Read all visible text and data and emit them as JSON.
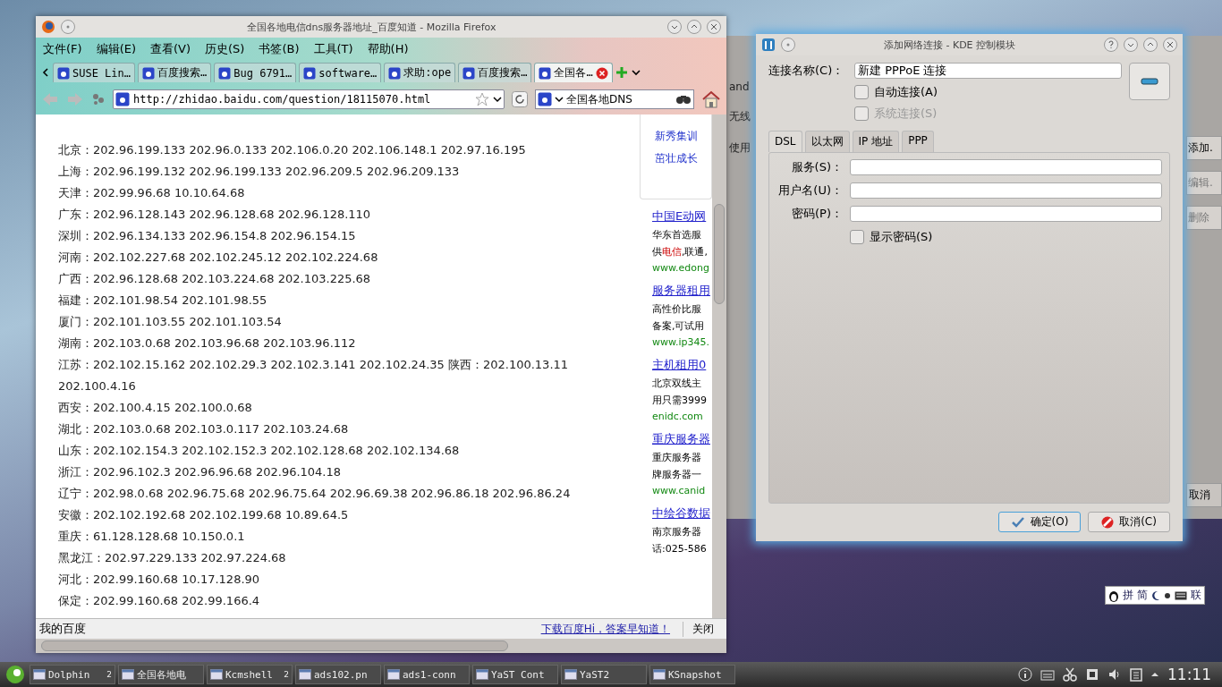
{
  "firefox": {
    "title": "全国各地电信dns服务器地址_百度知道 - Mozilla Firefox",
    "menu": [
      "文件(F)",
      "编辑(E)",
      "查看(V)",
      "历史(S)",
      "书签(B)",
      "工具(T)",
      "帮助(H)"
    ],
    "tabs": [
      {
        "label": "SUSE Lin…",
        "selected": false
      },
      {
        "label": "百度搜索…",
        "selected": false
      },
      {
        "label": "Bug 6791…",
        "selected": false
      },
      {
        "label": "software…",
        "selected": false
      },
      {
        "label": "求助:ope",
        "selected": false
      },
      {
        "label": "百度搜索…",
        "selected": false
      },
      {
        "label": "全国各…",
        "selected": true
      }
    ],
    "address": "http://zhidao.baidu.com/question/18115070.html",
    "search": "全国各地DNS",
    "lines": [
      "北京：202.96.199.133  202.96.0.133  202.106.0.20  202.106.148.1  202.97.16.195",
      "上海：202.96.199.132  202.96.199.133  202.96.209.5  202.96.209.133",
      "天津：202.99.96.68  10.10.64.68",
      "广东：202.96.128.143  202.96.128.68  202.96.128.110",
      "深圳：202.96.134.133  202.96.154.8  202.96.154.15",
      "河南：202.102.227.68  202.102.245.12  202.102.224.68",
      "广西：202.96.128.68  202.103.224.68  202.103.225.68",
      "福建：202.101.98.54  202.101.98.55",
      "厦门：202.101.103.55  202.101.103.54",
      "湖南：202.103.0.68  202.103.96.68  202.103.96.112",
      "江苏：202.102.15.162  202.102.29.3  202.102.3.141  202.102.24.35 陕西：202.100.13.11 202.100.4.16",
      "西安：202.100.4.15  202.100.0.68",
      "湖北：202.103.0.68  202.103.0.117  202.103.24.68",
      "山东：202.102.154.3  202.102.152.3  202.102.128.68  202.102.134.68",
      "浙江：202.96.102.3  202.96.96.68  202.96.104.18",
      "辽宁：202.98.0.68  202.96.75.68  202.96.75.64  202.96.69.38  202.96.86.18  202.96.86.24",
      "安徽：202.102.192.68  202.102.199.68  10.89.64.5",
      "重庆：61.128.128.68  10.150.0.1",
      "黑龙江：202.97.229.133  202.97.224.68",
      "河北：202.99.160.68  10.17.128.90",
      "保定：202.99.160.68  202.99.166.4"
    ],
    "side_links": [
      "新秀集训",
      "茁壮成长"
    ],
    "ads": [
      {
        "title": "中国E动网",
        "lines": [
          [
            {
              "text": "华东首选服"
            }
          ],
          [
            {
              "text": "供"
            },
            {
              "text": "电信",
              "highlight": true
            },
            {
              "text": ",联通,"
            }
          ]
        ],
        "url": "www.edong"
      },
      {
        "title": "服务器租用",
        "lines": [
          [
            {
              "text": "高性价比服"
            }
          ],
          [
            {
              "text": "备案,可试用"
            }
          ]
        ],
        "url": "www.ip345."
      },
      {
        "title": "主机租用0",
        "lines": [
          [
            {
              "text": "北京双线主"
            }
          ],
          [
            {
              "text": "用只需3999"
            }
          ]
        ],
        "url": "enidc.com"
      },
      {
        "title": "重庆服务器",
        "lines": [
          [
            {
              "text": "重庆服务器"
            }
          ],
          [
            {
              "text": "牌服务器一"
            }
          ]
        ],
        "url": "www.canid"
      },
      {
        "title": "中绘谷数据",
        "lines": [
          [
            {
              "text": "南京服务器"
            }
          ],
          [
            {
              "text": "话:025-586"
            }
          ]
        ]
      }
    ],
    "find_bar": {
      "left": "我的百度",
      "link": "下载百度Hi，答案早知道！",
      "close": "关闭"
    }
  },
  "background_window": {
    "left_texts": [
      "and",
      "无线",
      "使用"
    ],
    "buttons": [
      {
        "label": "添加.",
        "disabled": false
      },
      {
        "label": "编辑.",
        "disabled": true
      },
      {
        "label": "删除",
        "disabled": true
      }
    ],
    "cancel": "取消"
  },
  "dialog": {
    "title": "添加网络连接 - KDE 控制模块",
    "name_label": "连接名称(C)：",
    "name_value": "新建 PPPoE 连接",
    "checks": [
      {
        "label": "自动连接(A)",
        "checked": false,
        "disabled": false
      },
      {
        "label": "系统连接(S)",
        "checked": false,
        "disabled": true
      }
    ],
    "tabs": [
      {
        "label": "DSL",
        "selected": true
      },
      {
        "label": "以太网",
        "selected": false
      },
      {
        "label": "IP 地址",
        "selected": false
      },
      {
        "label": "PPP",
        "selected": false
      }
    ],
    "fields": [
      {
        "label": "服务(S)："
      },
      {
        "label": "用户名(U)："
      },
      {
        "label": "密码(P)："
      }
    ],
    "show_password": {
      "label": "显示密码(S)",
      "checked": false
    },
    "buttons": [
      {
        "label": "确定(O)",
        "kind": "ok",
        "default": true
      },
      {
        "label": "取消(C)",
        "kind": "cancel",
        "default": false
      }
    ]
  },
  "ime": [
    "拼",
    "简",
    "联"
  ],
  "taskbar": {
    "tasks": [
      {
        "label": "Dolphin",
        "count": "2"
      },
      {
        "label": "全国各地电"
      },
      {
        "label": "Kcmshell",
        "count": "2"
      },
      {
        "label": "ads102.pn"
      },
      {
        "label": "ads1-conn"
      },
      {
        "label": "YaST Cont"
      },
      {
        "label": "YaST2"
      },
      {
        "label": "KSnapshot"
      }
    ],
    "clock": "11:11"
  }
}
